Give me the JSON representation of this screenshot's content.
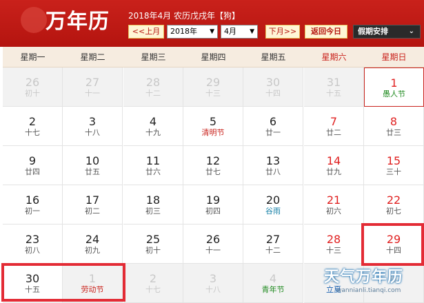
{
  "header": {
    "logo": "万年历",
    "title": "2018年4月 农历戊戌年【狗】",
    "prev_month": "<<上月",
    "year_select": "2018年",
    "month_select": "4月",
    "next_month": "下月>>",
    "today_button": "返回今日",
    "holiday_select": "假期安排"
  },
  "weekdays": [
    "星期一",
    "星期二",
    "星期三",
    "星期四",
    "星期五",
    "星期六",
    "星期日"
  ],
  "weeks": [
    [
      {
        "day": "26",
        "lunar": "初十",
        "other": true
      },
      {
        "day": "27",
        "lunar": "十一",
        "other": true
      },
      {
        "day": "28",
        "lunar": "十二",
        "other": true
      },
      {
        "day": "29",
        "lunar": "十三",
        "other": true
      },
      {
        "day": "30",
        "lunar": "十四",
        "other": true
      },
      {
        "day": "31",
        "lunar": "十五",
        "other": true
      },
      {
        "day": "1",
        "lunar": "愚人节",
        "fest": "green",
        "today": true
      }
    ],
    [
      {
        "day": "2",
        "lunar": "十七"
      },
      {
        "day": "3",
        "lunar": "十八"
      },
      {
        "day": "4",
        "lunar": "十九"
      },
      {
        "day": "5",
        "lunar": "清明节",
        "fest": "red"
      },
      {
        "day": "6",
        "lunar": "廿一"
      },
      {
        "day": "7",
        "lunar": "廿二"
      },
      {
        "day": "8",
        "lunar": "廿三"
      }
    ],
    [
      {
        "day": "9",
        "lunar": "廿四"
      },
      {
        "day": "10",
        "lunar": "廿五"
      },
      {
        "day": "11",
        "lunar": "廿六"
      },
      {
        "day": "12",
        "lunar": "廿七"
      },
      {
        "day": "13",
        "lunar": "廿八"
      },
      {
        "day": "14",
        "lunar": "廿九"
      },
      {
        "day": "15",
        "lunar": "三十"
      }
    ],
    [
      {
        "day": "16",
        "lunar": "初一"
      },
      {
        "day": "17",
        "lunar": "初二"
      },
      {
        "day": "18",
        "lunar": "初三"
      },
      {
        "day": "19",
        "lunar": "初四"
      },
      {
        "day": "20",
        "lunar": "谷雨",
        "fest": "teal"
      },
      {
        "day": "21",
        "lunar": "初六"
      },
      {
        "day": "22",
        "lunar": "初七"
      }
    ],
    [
      {
        "day": "23",
        "lunar": "初八"
      },
      {
        "day": "24",
        "lunar": "初九"
      },
      {
        "day": "25",
        "lunar": "初十"
      },
      {
        "day": "26",
        "lunar": "十一"
      },
      {
        "day": "27",
        "lunar": "十二"
      },
      {
        "day": "28",
        "lunar": "十三"
      },
      {
        "day": "29",
        "lunar": "十四"
      }
    ],
    [
      {
        "day": "30",
        "lunar": "十五"
      },
      {
        "day": "1",
        "lunar": "劳动节",
        "fest": "red",
        "other": true
      },
      {
        "day": "2",
        "lunar": "十七",
        "other": true
      },
      {
        "day": "3",
        "lunar": "十八",
        "other": true
      },
      {
        "day": "4",
        "lunar": "青年节",
        "fest": "green",
        "other": true
      },
      {
        "day": "5",
        "lunar": "立夏",
        "fest": "blue",
        "other": true
      },
      {
        "day": "6",
        "lunar": "",
        "other": true
      }
    ]
  ],
  "watermark": {
    "name": "天气万年历",
    "url": "wannianli.tianqi.com"
  },
  "colors": {
    "header_red": "#c9211b",
    "weekend_red": "#e02020",
    "highlight": "#e32b35"
  }
}
